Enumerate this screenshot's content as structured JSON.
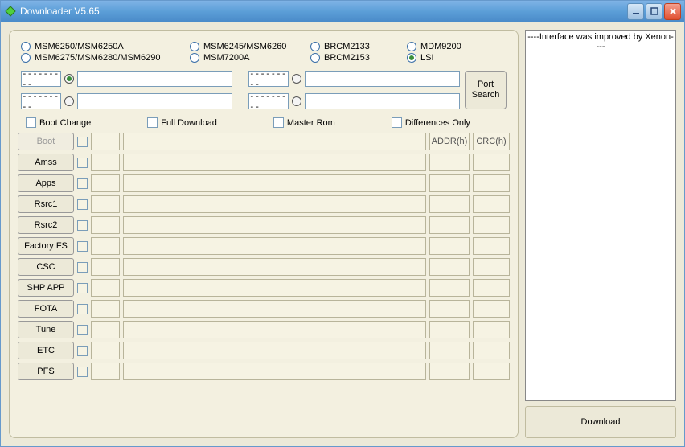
{
  "window": {
    "title": "Downloader V5.65"
  },
  "radios": {
    "row1": [
      "MSM6250/MSM6250A",
      "MSM6245/MSM6260",
      "BRCM2133",
      "MDM9200"
    ],
    "row2": [
      "MSM6275/MSM6280/MSM6290",
      "MSM7200A",
      "BRCM2153",
      "LSI"
    ],
    "selected": "LSI"
  },
  "ports": {
    "combo_placeholder": "---------",
    "selected_index": 0,
    "button": "Port\nSearch"
  },
  "checks": [
    "Boot Change",
    "Full Download",
    "Master Rom",
    "Differences Only"
  ],
  "headers": {
    "addr": "ADDR(h)",
    "crc": "CRC(h)"
  },
  "rows": [
    {
      "label": "Boot",
      "disabled": true
    },
    {
      "label": "Amss"
    },
    {
      "label": "Apps"
    },
    {
      "label": "Rsrc1"
    },
    {
      "label": "Rsrc2"
    },
    {
      "label": "Factory FS"
    },
    {
      "label": "CSC"
    },
    {
      "label": "SHP APP"
    },
    {
      "label": "FOTA"
    },
    {
      "label": "Tune"
    },
    {
      "label": "ETC"
    },
    {
      "label": "PFS"
    }
  ],
  "log": "----Interface was improved by Xenon----",
  "download": "Download"
}
